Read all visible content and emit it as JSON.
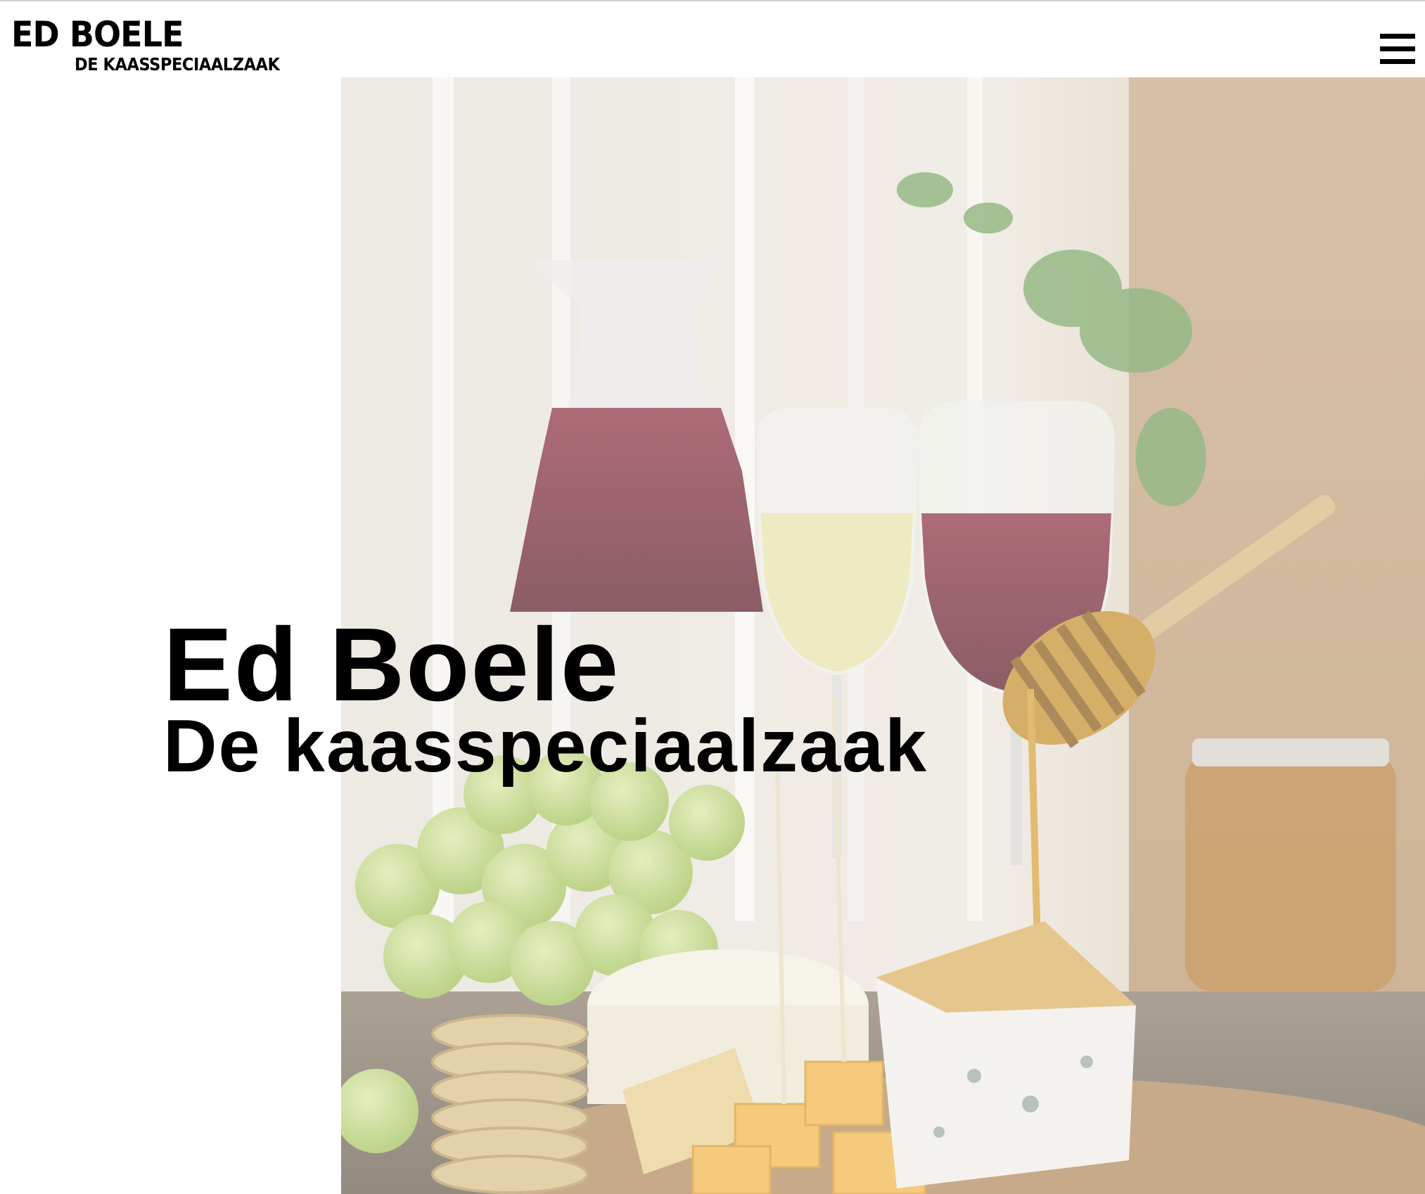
{
  "header": {
    "logo_title": "ED BOELE",
    "logo_subtitle": "DE KAASSPECIAALZAAK"
  },
  "hero": {
    "title_line1": "Ed Boele",
    "title_line2": "De kaasspeciaalzaak"
  },
  "icons": {
    "menu": "hamburger-menu-icon"
  }
}
